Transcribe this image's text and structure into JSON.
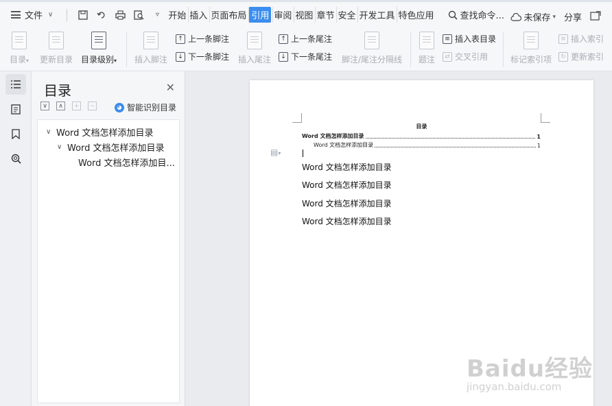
{
  "menubar": {
    "file_label": "文件",
    "tabs": [
      {
        "label": "开始",
        "active": false
      },
      {
        "label": "插入",
        "active": false
      },
      {
        "label": "页面布局",
        "active": false
      },
      {
        "label": "引用",
        "active": true
      },
      {
        "label": "审阅",
        "active": false
      },
      {
        "label": "视图",
        "active": false
      },
      {
        "label": "章节",
        "active": false
      },
      {
        "label": "安全",
        "active": false
      },
      {
        "label": "开发工具",
        "active": false
      },
      {
        "label": "特色应用",
        "active": false
      }
    ],
    "search_label": "查找命令...",
    "unsaved_label": "未保存",
    "share_label": "分享"
  },
  "ribbon": {
    "toc": "目录",
    "update_toc": "更新目录",
    "toc_level": "目录级别",
    "insert_footnote": "插入脚注",
    "prev_footnote": "上一条脚注",
    "next_footnote": "下一条脚注",
    "insert_endnote": "插入尾注",
    "prev_endnote": "上一条尾注",
    "next_endnote": "下一条尾注",
    "footnote_separator": "脚注/尾注分隔线",
    "caption": "题注",
    "insert_table_toc": "插入表目录",
    "cross_ref": "交叉引用",
    "mark_index": "标记索引项",
    "insert_index": "插入索引",
    "update_index": "更新索引"
  },
  "panel": {
    "title": "目录",
    "smart_label": "智能识别目录",
    "items": [
      {
        "label": "Word 文档怎样添加目录"
      },
      {
        "label": "Word 文档怎样添加目录"
      },
      {
        "label": "Word 文档怎样添加目..."
      }
    ]
  },
  "document": {
    "toc_heading": "目录",
    "toc_entries": [
      {
        "text": "Word 文档怎样添加目录",
        "page": "1"
      },
      {
        "text": "Word 文档怎样添加目录",
        "page": "1"
      }
    ],
    "paragraphs": [
      "Word 文档怎样添加目录",
      "Word 文档怎样添加目录",
      "Word 文档怎样添加目录",
      "Word 文档怎样添加目录"
    ]
  },
  "watermark": {
    "logo": "Baidu经验",
    "url": "jingyan.baidu.com"
  }
}
